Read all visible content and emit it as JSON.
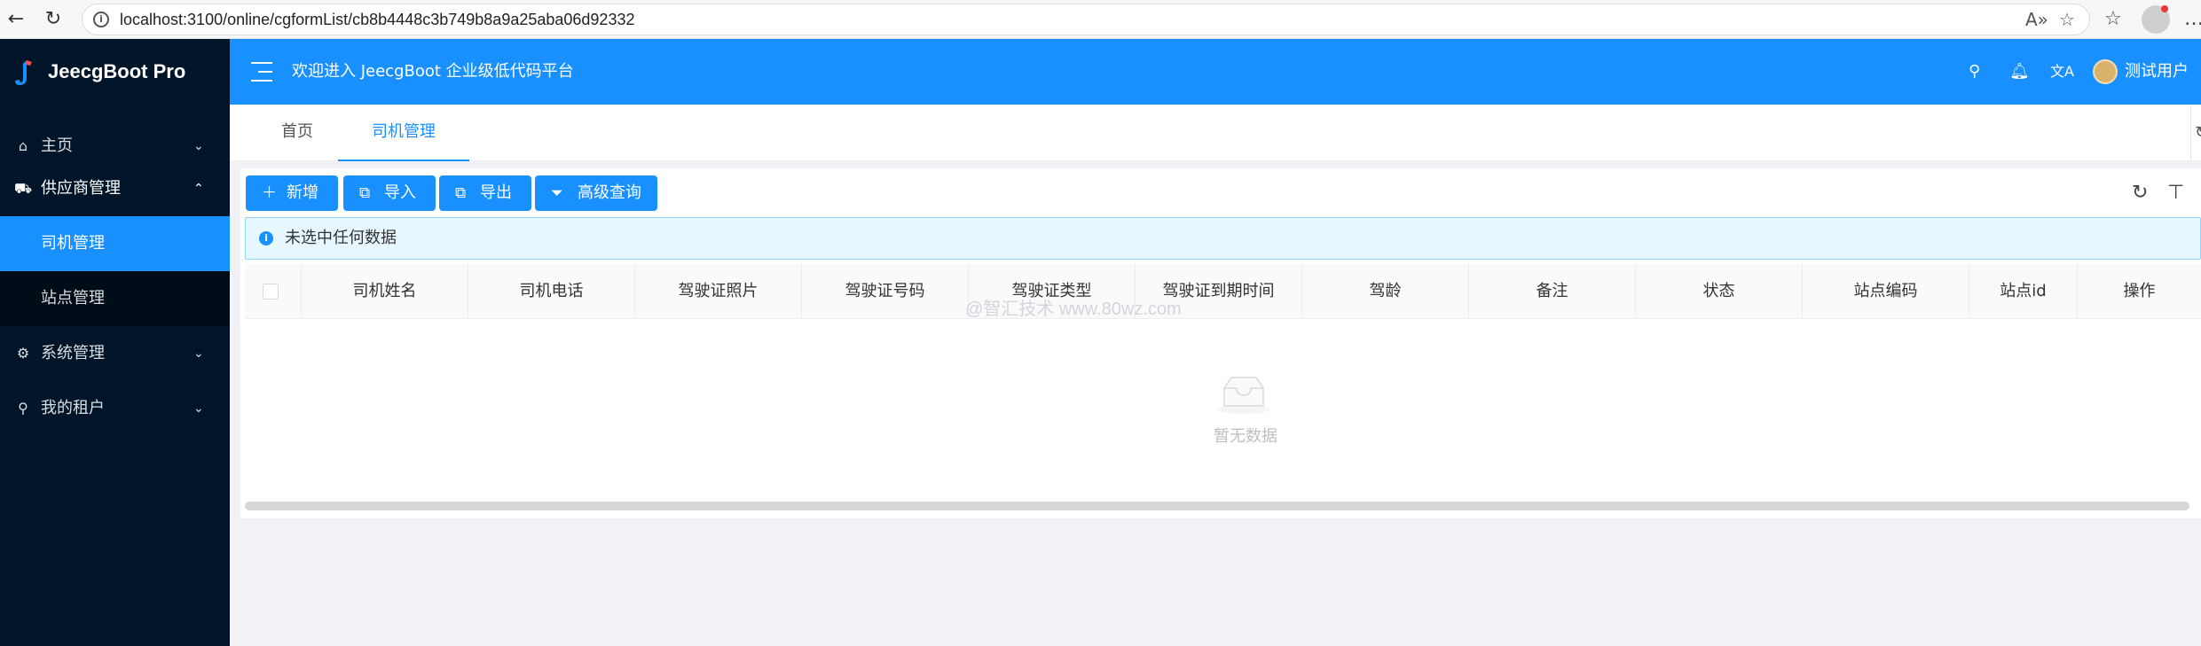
{
  "browser": {
    "url": "localhost:3100/online/cgformList/cb8b4448c3b749b8a9a25aba06d92332",
    "back_icon": "arrow-left-icon",
    "refresh_icon": "refresh-icon"
  },
  "app": {
    "name": "JeecgBoot Pro",
    "welcome": "欢迎进入 JeecgBoot 企业级低代码平台",
    "username": "测试用户",
    "accent": "#1890ff",
    "sidebar_bg": "#001529"
  },
  "sidebar": {
    "items": [
      {
        "label": "主页",
        "icon": "home-icon"
      },
      {
        "label": "供应商管理",
        "icon": "supplier-icon",
        "expanded": true
      },
      {
        "label": "司机管理",
        "active": true
      },
      {
        "label": "站点管理"
      },
      {
        "label": "系统管理",
        "icon": "gear-icon"
      },
      {
        "label": "我的租户",
        "icon": "user-icon"
      }
    ]
  },
  "tabs": [
    {
      "label": "首页"
    },
    {
      "label": "司机管理",
      "active": true
    }
  ],
  "toolbar": {
    "add": "新增",
    "import": "导入",
    "export": "导出",
    "advanced_query": "高级查询"
  },
  "alert": {
    "text": "未选中任何数据"
  },
  "table": {
    "columns": [
      "司机姓名",
      "司机电话",
      "驾驶证照片",
      "驾驶证号码",
      "驾驶证类型",
      "驾驶证到期时间",
      "驾龄",
      "备注",
      "状态",
      "站点编码",
      "站点id",
      "操作"
    ],
    "empty_text": "暂无数据"
  },
  "watermark": "@智汇技术 www.80wz.com"
}
